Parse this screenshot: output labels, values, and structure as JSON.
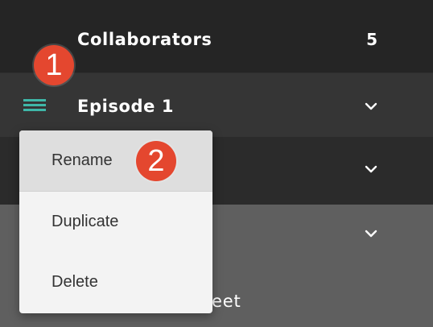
{
  "rows": {
    "collaborators": {
      "label": "Collaborators",
      "count": "5"
    },
    "episode": {
      "label": "Episode 1"
    },
    "fourth": {
      "partial_text": "eet"
    }
  },
  "annotations": {
    "step_1": "1",
    "step_2": "2"
  },
  "context_menu": {
    "items": [
      {
        "label": "Rename"
      },
      {
        "label": "Duplicate"
      },
      {
        "label": "Delete"
      }
    ]
  },
  "colors": {
    "accent_teal": "#3fb7a8",
    "badge_red": "#e4472f",
    "menu_bg": "#f3f3f3"
  },
  "icons": {
    "menu_handle": "hamburger-icon",
    "expand": "chevron-down-icon"
  }
}
